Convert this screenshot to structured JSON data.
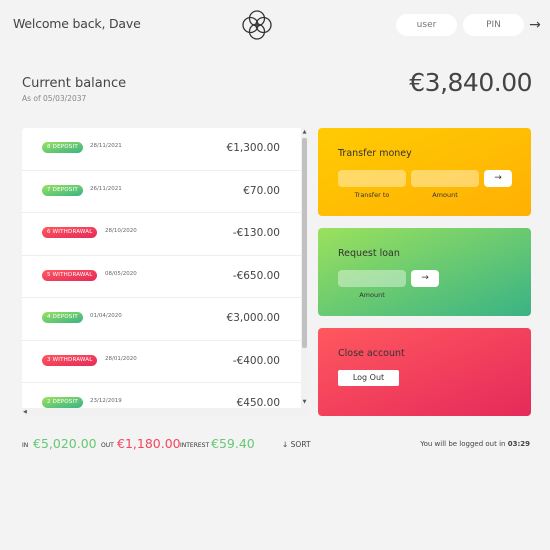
{
  "header": {
    "welcome": "Welcome back, Dave",
    "user_placeholder": "user",
    "pin_placeholder": "PIN",
    "login_button": "→"
  },
  "balance": {
    "label": "Current balance",
    "date": "As of 05/03/2037",
    "value": "€3,840.00"
  },
  "movements": [
    {
      "type": "8 deposit",
      "kind": "deposit",
      "date": "28/11/2021",
      "value": "€1,300.00"
    },
    {
      "type": "7 deposit",
      "kind": "deposit",
      "date": "26/11/2021",
      "value": "€70.00"
    },
    {
      "type": "6 withdrawal",
      "kind": "withdrawal",
      "date": "28/10/2020",
      "value": "-€130.00"
    },
    {
      "type": "5 withdrawal",
      "kind": "withdrawal",
      "date": "08/05/2020",
      "value": "-€650.00"
    },
    {
      "type": "4 deposit",
      "kind": "deposit",
      "date": "01/04/2020",
      "value": "€3,000.00"
    },
    {
      "type": "3 withdrawal",
      "kind": "withdrawal",
      "date": "28/01/2020",
      "value": "-€400.00"
    },
    {
      "type": "2 deposit",
      "kind": "deposit",
      "date": "23/12/2019",
      "value": "€450.00"
    }
  ],
  "operations": {
    "transfer": {
      "title": "Transfer money",
      "to_label": "Transfer to",
      "amount_label": "Amount",
      "button": "→"
    },
    "loan": {
      "title": "Request loan",
      "amount_label": "Amount",
      "button": "→"
    },
    "close": {
      "title": "Close account",
      "button": "Log Out"
    }
  },
  "summary": {
    "in_label": "In",
    "in_value": "€5,020.00",
    "out_label": "Out",
    "out_value": "€1,180.00",
    "interest_label": "Interest",
    "interest_value": "€59.40",
    "sort": "↓ SORT"
  },
  "logout_timer": {
    "text": "You will be logged out in",
    "time": "03:29"
  },
  "colors": {
    "deposit": "#66c873",
    "withdrawal": "#f5465d",
    "transfer_card": "#ffbb03",
    "loan_card": "#6fcc72",
    "close_card": "#f23f5d"
  }
}
